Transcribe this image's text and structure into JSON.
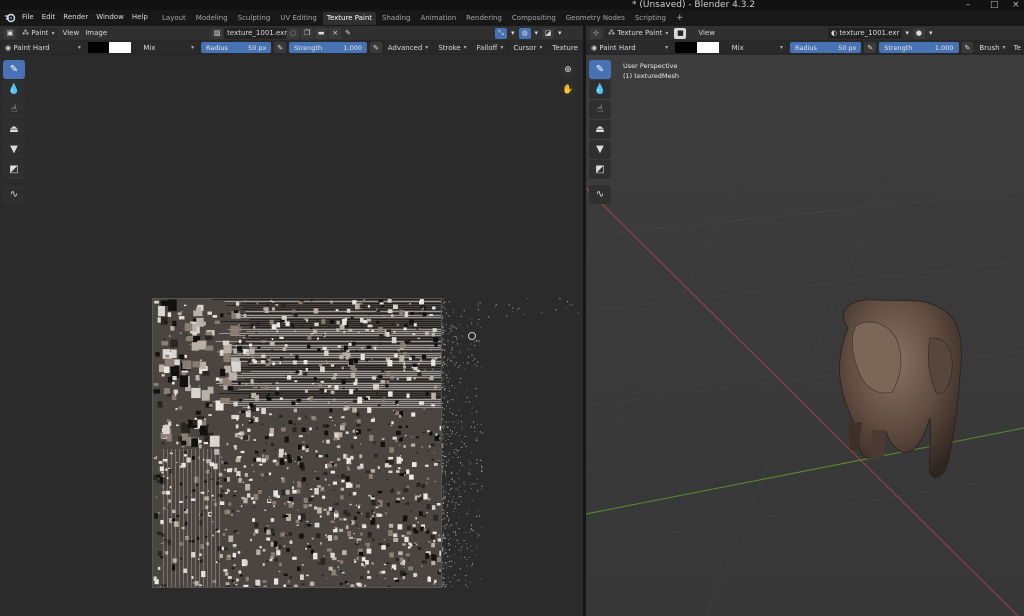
{
  "window": {
    "title": "* (Unsaved) - Blender 4.3.2",
    "minimize_glyph": "–",
    "maximize_glyph": "□",
    "close_glyph": "×"
  },
  "menu": [
    "File",
    "Edit",
    "Render",
    "Window",
    "Help"
  ],
  "workspaces": {
    "tabs": [
      "Layout",
      "Modeling",
      "Sculpting",
      "UV Editing",
      "Texture Paint",
      "Shading",
      "Animation",
      "Rendering",
      "Compositing",
      "Geometry Nodes",
      "Scripting"
    ],
    "active": "Texture Paint",
    "add_glyph": "+"
  },
  "image_editor": {
    "mode": "Paint",
    "menus": [
      "View",
      "Image"
    ],
    "image_name": "texture_1001.exr",
    "tool_settings": {
      "brush": "Paint Hard",
      "blend": "Mix",
      "radius_label": "Radius",
      "radius_value": "50 px",
      "strength_label": "Strength",
      "strength_value": "1.000",
      "panels": [
        "Advanced",
        "Stroke",
        "Falloff",
        "Cursor",
        "Texture"
      ]
    },
    "tools": [
      "brush-icon",
      "blur-icon",
      "smear-icon",
      "clone-icon",
      "fill-icon",
      "mask-icon",
      "annotate-icon"
    ]
  },
  "viewport": {
    "mode": "Texture Paint",
    "menus": [
      "View"
    ],
    "image_name": "texture_1001.exr",
    "overlay_line1": "User Perspective",
    "overlay_line2": "(1) texturedMesh",
    "tool_settings": {
      "brush": "Paint Hard",
      "blend": "Mix",
      "radius_label": "Radius",
      "radius_value": "50 px",
      "strength_label": "Strength",
      "strength_value": "1.000",
      "panels": [
        "Brush",
        "Te"
      ]
    }
  },
  "colors": {
    "accent": "#4772b3",
    "primary_swatch": "#000000",
    "secondary_swatch": "#ffffff",
    "x_axis": "#a0424a",
    "y_axis": "#5f8a2a"
  }
}
